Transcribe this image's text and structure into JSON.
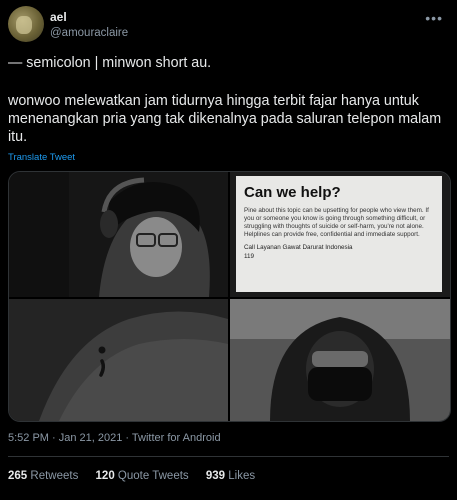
{
  "tweet": {
    "display_name": "ael",
    "handle": "@amouraclaire",
    "more_icon": "more-icon",
    "line1": "— semicolon | minwon short au.",
    "line2": "wonwoo melewatkan jam tidurnya hingga terbit fajar hanya untuk menenangkan pria yang tak dikenalnya pada saluran telepon malam itu.",
    "translate_label": "Translate Tweet",
    "timestamp": "5:52 PM · Jan 21, 2021 · Twitter for Android"
  },
  "help_card": {
    "title": "Can we help?",
    "body": "Pine about this topic can be upsetting for people who view them. If you or someone you know is going through something difficult, or struggling with thoughts of suicide or self-harm, you're not alone. Helplines can provide free, confidential and immediate support.",
    "call_label": "Call Layanan Gawat Darurat Indonesia",
    "number": "119"
  },
  "stats": {
    "retweets_count": "265",
    "retweets_label": "Retweets",
    "quotes_count": "120",
    "quotes_label": "Quote Tweets",
    "likes_count": "939",
    "likes_label": "Likes"
  }
}
